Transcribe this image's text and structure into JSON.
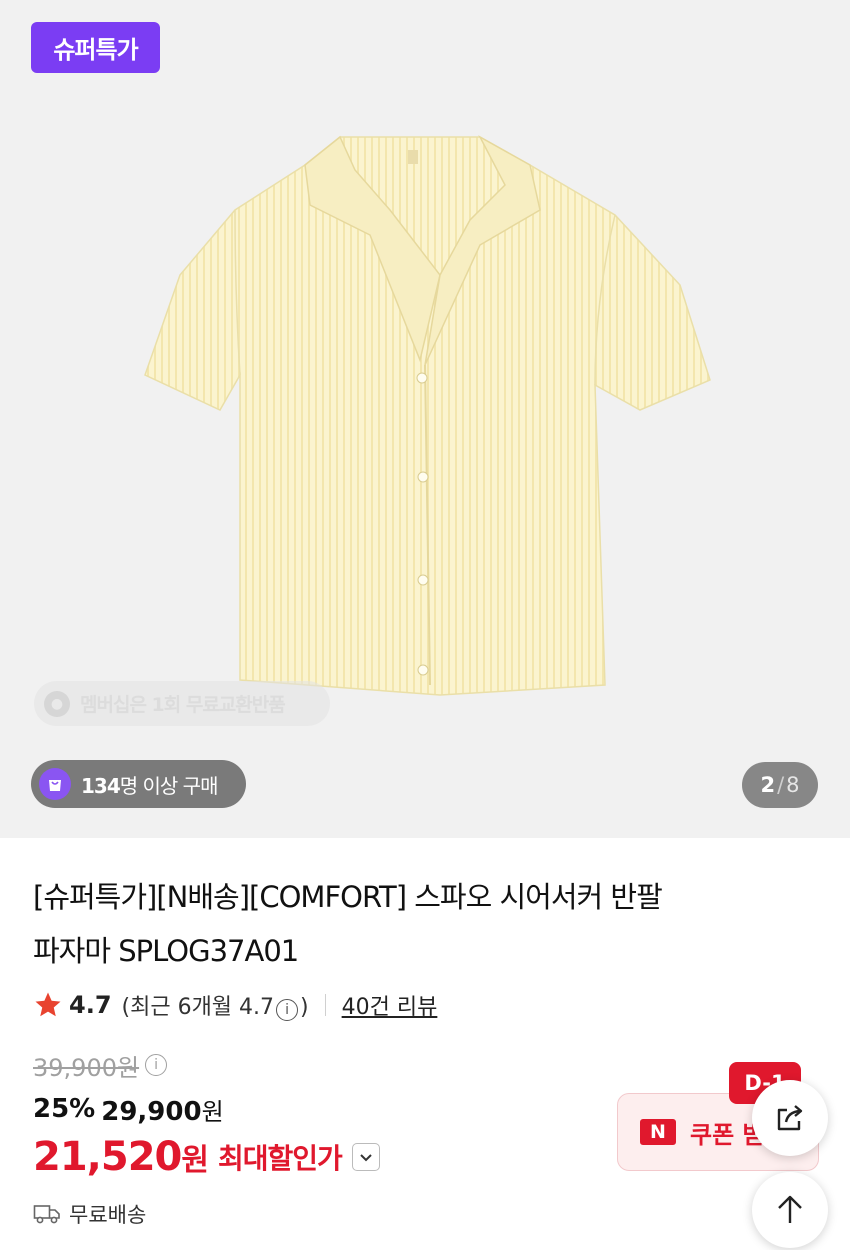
{
  "hero": {
    "badge": "슈퍼특가",
    "watermark_text": "멤버십은 1회 무료교환반품",
    "buyers_count": "134",
    "buyers_suffix": "명 이상 구매",
    "pager_current": "2",
    "pager_sep": "/",
    "pager_total": "8"
  },
  "product": {
    "title_line1": "[슈퍼특가][N배송][COMFORT] 스파오 시어서커 반팔",
    "title_line2": "파자마 SPLOG37A01"
  },
  "rating": {
    "score": "4.7",
    "recent_prefix": "(최근 6개월 4.7",
    "info_glyph": "i",
    "recent_suffix": ")",
    "reviews": "40건 리뷰"
  },
  "price": {
    "original": "39,900원",
    "discount_rate": "25%",
    "sale": "29,900",
    "sale_unit": "원",
    "final": "21,520",
    "final_unit": "원",
    "max_discount_label": "최대할인가"
  },
  "delivery": {
    "label": "무료배송"
  },
  "coupon": {
    "logo": "N",
    "text": "쿠폰 받기",
    "dday": "D-1"
  },
  "colors": {
    "accent_purple": "#7b3df3",
    "price_red": "#e0182d",
    "star": "#e8432f"
  },
  "icons": {
    "share": "share-icon",
    "scroll_top": "arrow-up-icon",
    "truck": "truck-icon",
    "star": "star-icon",
    "bag": "shopping-bag-icon",
    "chevron": "chevron-down-icon"
  }
}
